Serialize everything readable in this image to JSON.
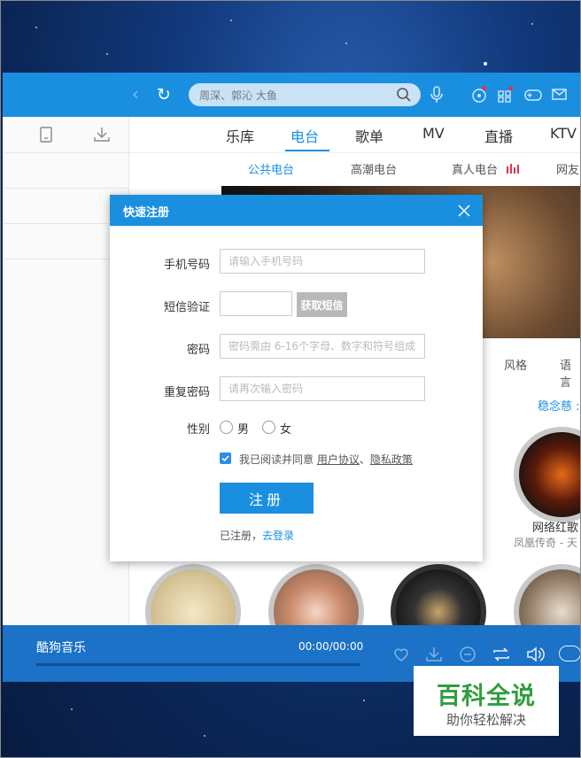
{
  "app": {
    "name": "酷狗音乐"
  },
  "search": {
    "placeholder": "周深、郭沁 大鱼"
  },
  "main_tabs": [
    "乐库",
    "电台",
    "歌单",
    "MV",
    "直播",
    "KTV"
  ],
  "active_tab": "电台",
  "sub_tabs": [
    "公共电台",
    "高潮电台",
    "真人电台",
    "网友"
  ],
  "filters": [
    "风格",
    "语言"
  ],
  "more_link": "稳念慈 :",
  "radio_cards": [
    {
      "title": "网络红歌",
      "sub": "凤凰传奇 - 天"
    }
  ],
  "player": {
    "title": "酷狗音乐",
    "time": "00:00/00:00"
  },
  "dialog": {
    "title": "快速注册",
    "phone_label": "手机号码",
    "phone_placeholder": "请输入手机号码",
    "sms_label": "短信验证",
    "sms_button": "获取短信",
    "password_label": "密码",
    "password_placeholder": "密码需由 6-16个字母、数字和符号组成",
    "repeat_label": "重复密码",
    "repeat_placeholder": "请再次输入密码",
    "gender_label": "性别",
    "gender_male": "男",
    "gender_female": "女",
    "agree_prefix": "我已阅读并同意",
    "agree_link1": "用户协议",
    "agree_sep": "、",
    "agree_link2": "隐私政策",
    "register_button": "注册",
    "login_prefix": "已注册，",
    "login_link": "去登录"
  },
  "watermark": {
    "title": "百科全说",
    "subtitle": "助你轻松解决"
  },
  "colors": {
    "accent": "#1a8fe0",
    "player": "#1b72c6",
    "watermark_green": "#2f9e3e"
  }
}
